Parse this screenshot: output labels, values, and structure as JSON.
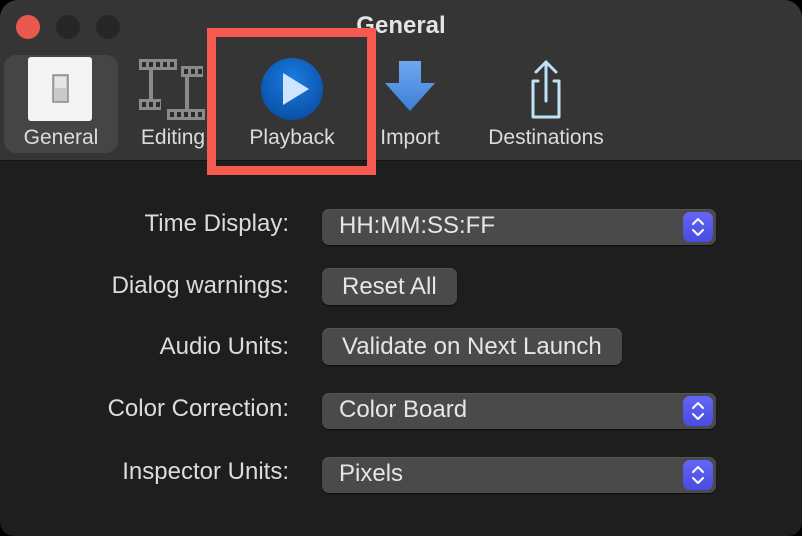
{
  "window": {
    "title": "General",
    "traffic_lights": {
      "close": "close-button",
      "minimize": "minimize-button",
      "zoom": "zoom-button"
    }
  },
  "toolbar": {
    "tabs": [
      {
        "id": "general",
        "label": "General",
        "icon": "switch-icon",
        "selected": true
      },
      {
        "id": "editing",
        "label": "Editing",
        "icon": "film-strip-icon",
        "selected": false
      },
      {
        "id": "playback",
        "label": "Playback",
        "icon": "play-circle-icon",
        "selected": false,
        "highlighted": true
      },
      {
        "id": "import",
        "label": "Import",
        "icon": "download-arrow-icon",
        "selected": false
      },
      {
        "id": "destinations",
        "label": "Destinations",
        "icon": "share-icon",
        "selected": false
      }
    ]
  },
  "settings": {
    "time_display": {
      "label": "Time Display:",
      "value": "HH:MM:SS:FF"
    },
    "dialog_warnings": {
      "label": "Dialog warnings:",
      "button": "Reset All"
    },
    "audio_units": {
      "label": "Audio Units:",
      "button": "Validate on Next Launch"
    },
    "color_correction": {
      "label": "Color Correction:",
      "value": "Color Board"
    },
    "inspector_units": {
      "label": "Inspector Units:",
      "value": "Pixels"
    }
  },
  "colors": {
    "accent": "#5558ef",
    "highlight_box": "#f45a4f",
    "close_light": "#e8584f"
  }
}
